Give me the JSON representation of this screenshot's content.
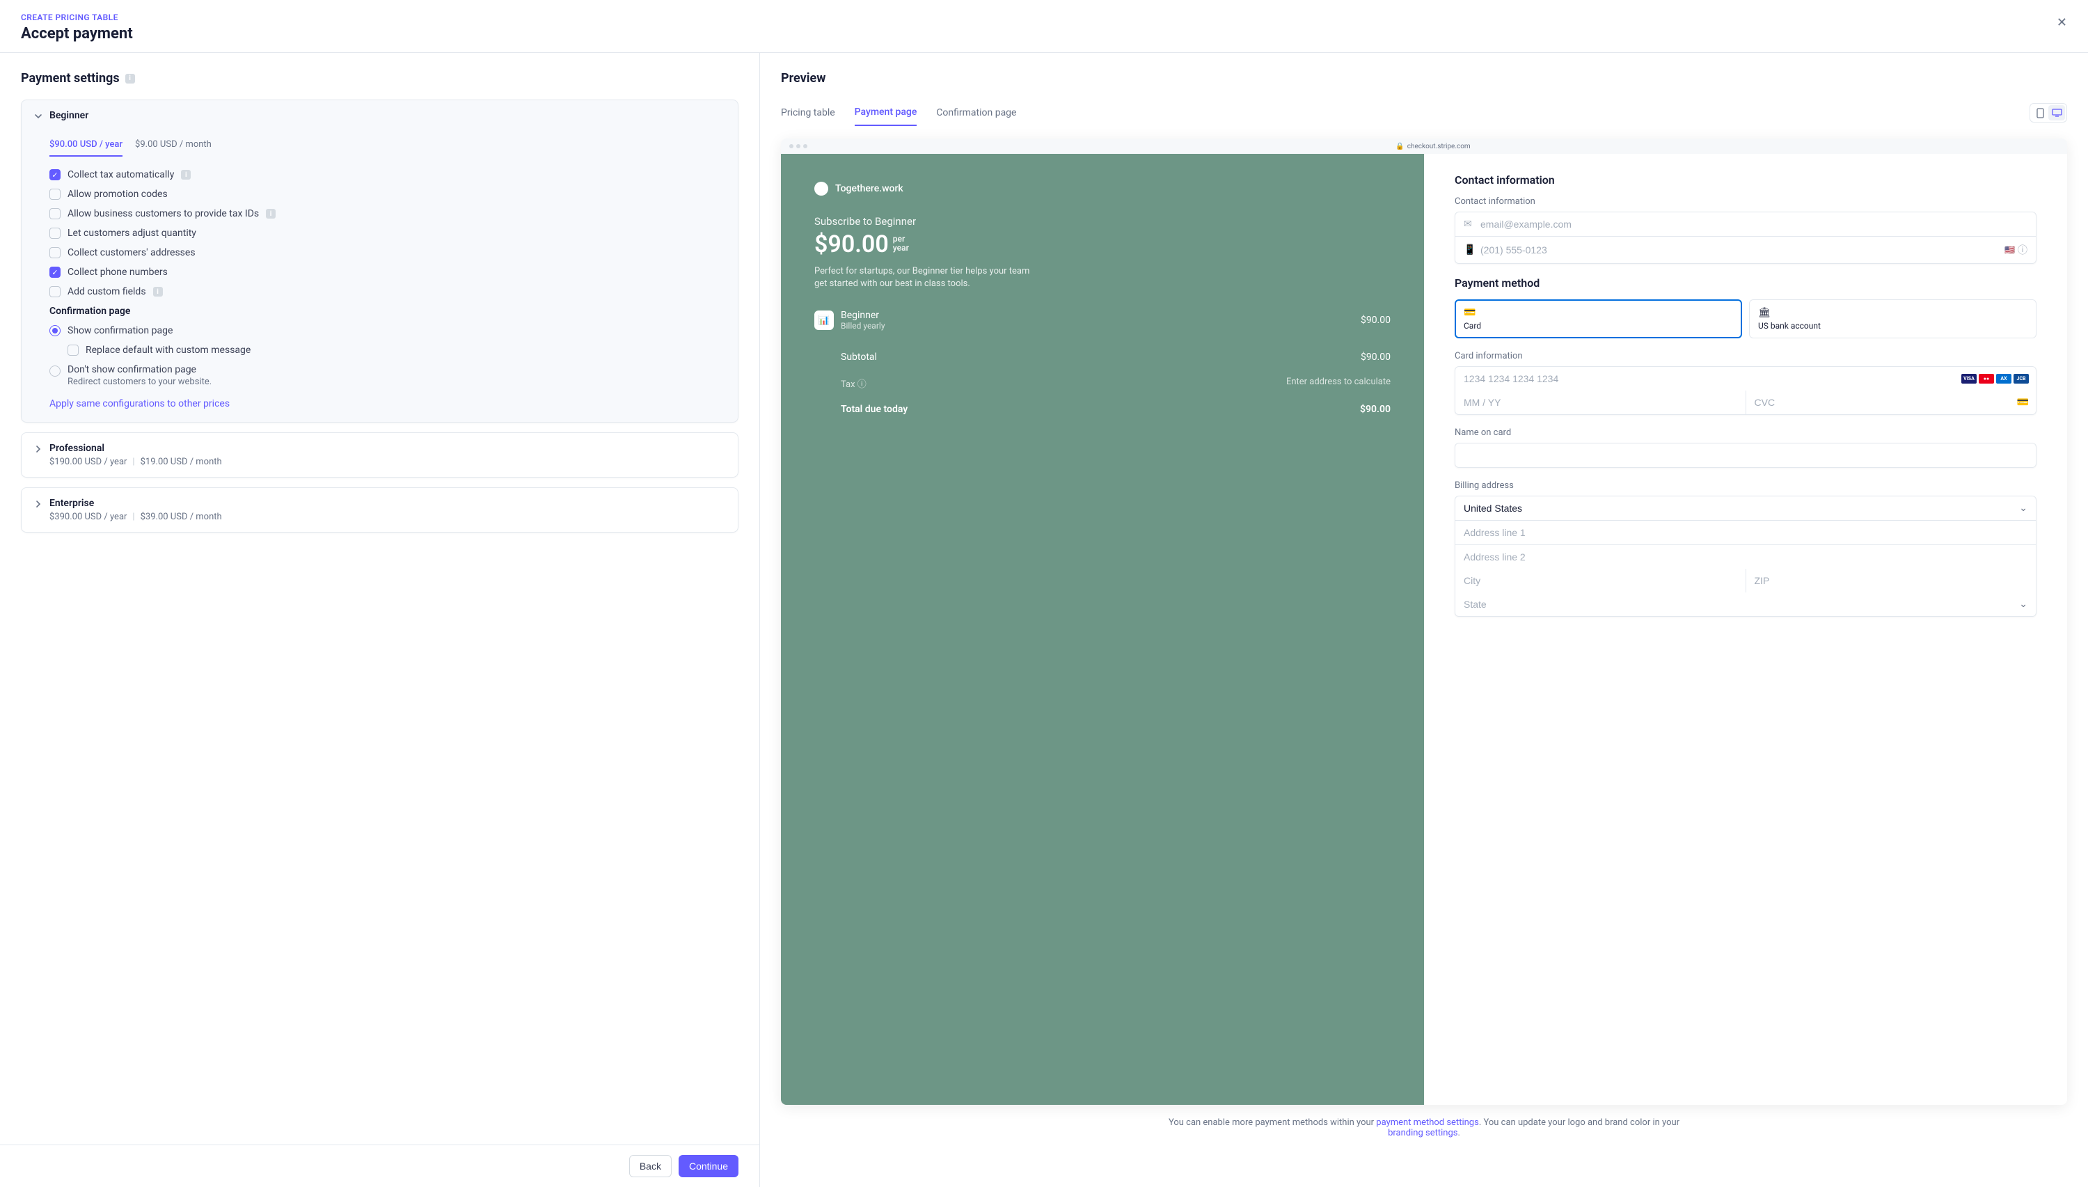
{
  "breadcrumb": "CREATE PRICING TABLE",
  "page_title": "Accept payment",
  "left": {
    "title": "Payment settings",
    "tiers": {
      "beginner": {
        "name": "Beginner",
        "year_price": "$90.00 USD / year",
        "month_price": "$9.00 USD / month",
        "checks": {
          "tax": "Collect tax automatically",
          "promo": "Allow promotion codes",
          "biz_tax": "Allow business customers to provide tax IDs",
          "qty": "Let customers adjust quantity",
          "addr": "Collect customers' addresses",
          "phone": "Collect phone numbers",
          "custom": "Add custom fields"
        },
        "conf_heading": "Confirmation page",
        "radio_show": "Show confirmation page",
        "replace_msg": "Replace default with custom message",
        "radio_hide": "Don't show confirmation page",
        "radio_hide_help": "Redirect customers to your website.",
        "apply_link": "Apply same configurations to other prices"
      },
      "professional": {
        "name": "Professional",
        "year_price": "$190.00 USD / year",
        "month_price": "$19.00 USD / month"
      },
      "enterprise": {
        "name": "Enterprise",
        "year_price": "$390.00 USD / year",
        "month_price": "$39.00 USD / month"
      }
    }
  },
  "right": {
    "title": "Preview",
    "tabs": {
      "pricing": "Pricing table",
      "payment": "Payment page",
      "confirmation": "Confirmation page"
    },
    "url": "checkout.stripe.com",
    "checkout": {
      "merchant": "Togethere.work",
      "subscribe": "Subscribe to Beginner",
      "price": "$90.00",
      "period1": "per",
      "period2": "year",
      "desc": "Perfect for startups, our Beginner tier helps your team get started with our best in class tools.",
      "plan_name": "Beginner",
      "plan_sub": "Billed yearly",
      "plan_amt": "$90.00",
      "subtotal_label": "Subtotal",
      "subtotal_amt": "$90.00",
      "tax_label": "Tax",
      "tax_hint": "Enter address to calculate",
      "total_label": "Total due today",
      "total_amt": "$90.00"
    },
    "form": {
      "contact_title": "Contact information",
      "contact_label": "Contact information",
      "email_ph": "email@example.com",
      "phone_ph": "(201) 555-0123",
      "method_title": "Payment method",
      "card_label": "Card",
      "bank_label": "US bank account",
      "card_info_label": "Card information",
      "card_num_ph": "1234 1234 1234 1234",
      "exp_ph": "MM / YY",
      "cvc_ph": "CVC",
      "name_label": "Name on card",
      "billing_label": "Billing address",
      "country": "United States",
      "addr1_ph": "Address line 1",
      "addr2_ph": "Address line 2",
      "city_ph": "City",
      "zip_ph": "ZIP",
      "state_ph": "State"
    },
    "footer": {
      "pre1": "You can enable more payment methods within your ",
      "link1": "payment method settings",
      "mid": ". You can update your logo and brand color in your ",
      "link2": "branding settings",
      "post": "."
    }
  },
  "buttons": {
    "back": "Back",
    "continue": "Continue"
  }
}
